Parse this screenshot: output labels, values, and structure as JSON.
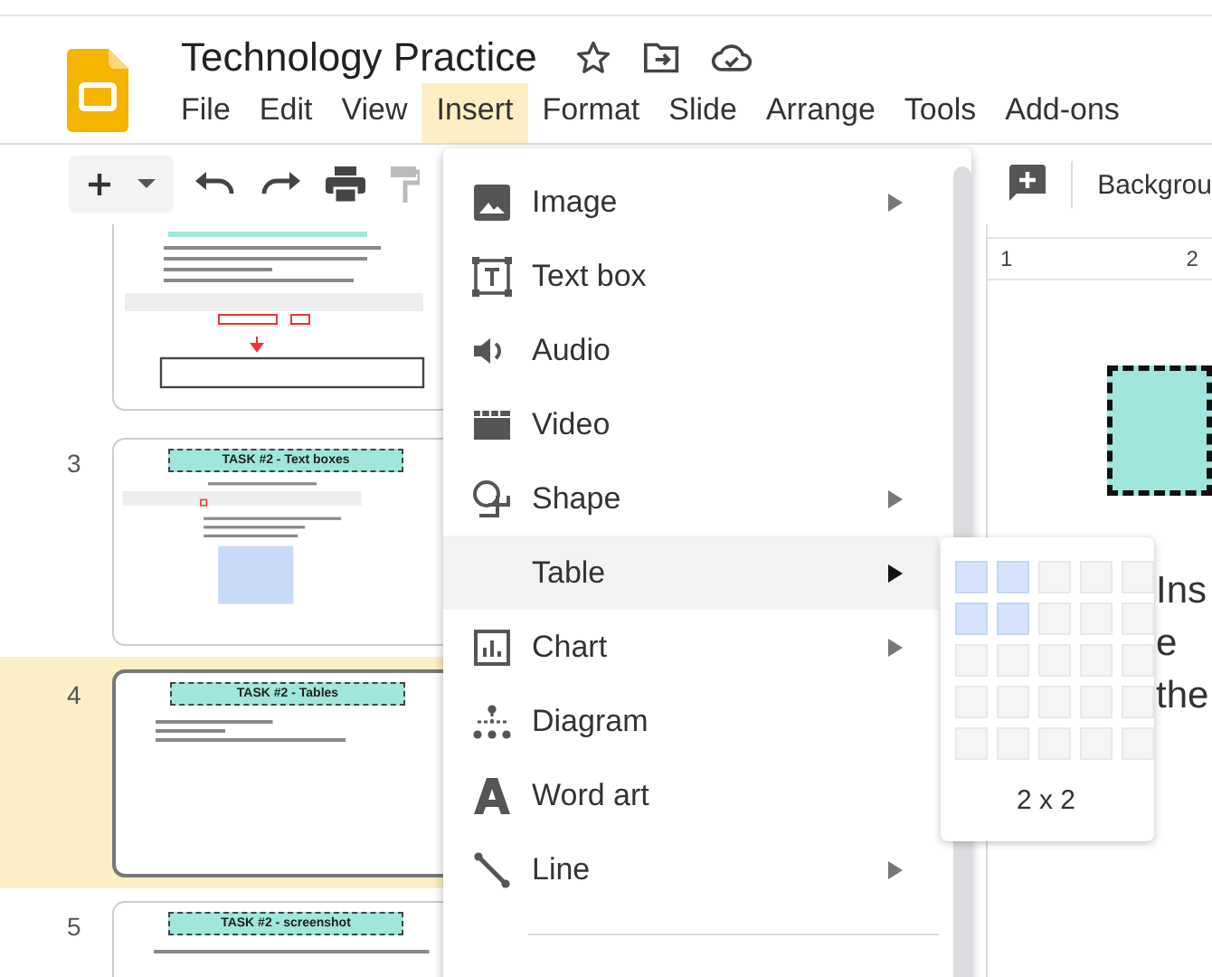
{
  "document": {
    "title": "Technology Practice"
  },
  "menu_bar": [
    {
      "label": "File",
      "selected": false
    },
    {
      "label": "Edit",
      "selected": false
    },
    {
      "label": "View",
      "selected": false
    },
    {
      "label": "Insert",
      "selected": true
    },
    {
      "label": "Format",
      "selected": false
    },
    {
      "label": "Slide",
      "selected": false
    },
    {
      "label": "Arrange",
      "selected": false
    },
    {
      "label": "Tools",
      "selected": false
    },
    {
      "label": "Add-ons",
      "selected": false
    }
  ],
  "toolbar": {
    "background_button": "Backgrou"
  },
  "slides": [
    {
      "kind": "partial",
      "selected": false
    },
    {
      "kind": "textbox_task",
      "number": "3",
      "header": "TASK #2 - Text boxes",
      "selected": false
    },
    {
      "kind": "tables_task",
      "number": "4",
      "header": "TASK #2 - Tables",
      "selected": true
    },
    {
      "kind": "screenshot_task",
      "number": "5",
      "header": "TASK #2 - screenshot",
      "selected": false
    }
  ],
  "insert_menu": {
    "items": [
      {
        "kind": "image",
        "label": "Image",
        "submenu": true,
        "selected": false
      },
      {
        "kind": "textbox",
        "label": "Text box",
        "submenu": false,
        "selected": false
      },
      {
        "kind": "audio",
        "label": "Audio",
        "submenu": false,
        "selected": false
      },
      {
        "kind": "video",
        "label": "Video",
        "submenu": false,
        "selected": false
      },
      {
        "kind": "shape",
        "label": "Shape",
        "submenu": true,
        "selected": false
      },
      {
        "kind": "table",
        "label": "Table",
        "submenu": true,
        "selected": true
      },
      {
        "kind": "chart",
        "label": "Chart",
        "submenu": true,
        "selected": false
      },
      {
        "kind": "diagram",
        "label": "Diagram",
        "submenu": false,
        "selected": false
      },
      {
        "kind": "wordart",
        "label": "Word art",
        "submenu": false,
        "selected": false
      },
      {
        "kind": "line",
        "label": "Line",
        "submenu": true,
        "selected": false
      }
    ]
  },
  "table_picker": {
    "rows": [
      {
        "cells": [
          {
            "selected": true
          },
          {
            "selected": true
          },
          {
            "selected": false
          },
          {
            "selected": false
          },
          {
            "selected": false
          }
        ]
      },
      {
        "cells": [
          {
            "selected": true
          },
          {
            "selected": true
          },
          {
            "selected": false
          },
          {
            "selected": false
          },
          {
            "selected": false
          }
        ]
      },
      {
        "cells": [
          {
            "selected": false
          },
          {
            "selected": false
          },
          {
            "selected": false
          },
          {
            "selected": false
          },
          {
            "selected": false
          }
        ]
      },
      {
        "cells": [
          {
            "selected": false
          },
          {
            "selected": false
          },
          {
            "selected": false
          },
          {
            "selected": false
          },
          {
            "selected": false
          }
        ]
      },
      {
        "cells": [
          {
            "selected": false
          },
          {
            "selected": false
          },
          {
            "selected": false
          },
          {
            "selected": false
          },
          {
            "selected": false
          }
        ]
      }
    ],
    "label": "2 x 2"
  },
  "canvas": {
    "ruler_labels": [
      "1",
      "2"
    ],
    "text_lines": [
      "Ins",
      "e",
      "the"
    ]
  }
}
